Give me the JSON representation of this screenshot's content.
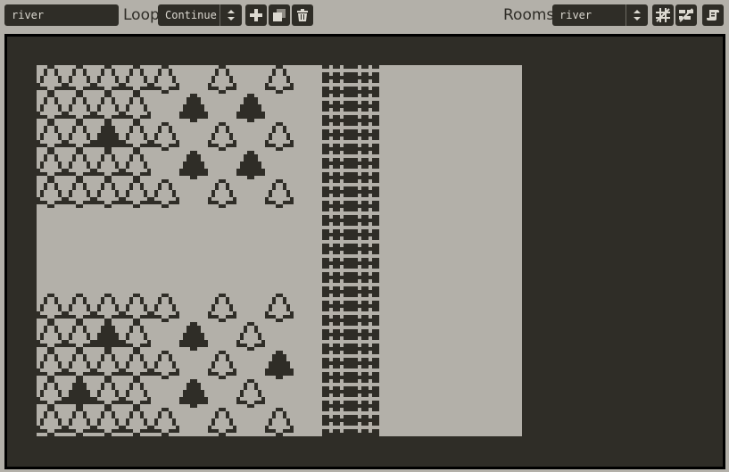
{
  "toolbar": {
    "room_name_value": "river",
    "loop_label": "Loop",
    "loop_select_value": "Continue",
    "rooms_label": "Rooms",
    "rooms_select_value": "river"
  },
  "colors": {
    "light": "#b3b0a9",
    "dark": "#2f2d27",
    "border": "#000000"
  },
  "game": {
    "grid_cols": 17,
    "grid_rows": 13,
    "rows": [
      "ooooo.o.o.MM.....",
      "oooo.T.T..MM.....",
      "ooToo.o.o.MM.....",
      "oooo.T.T..MM.....",
      "ooooo.o.o.MM.....",
      "..........MM.....",
      "..........MM.....",
      "..........MM.....",
      "ooooo.o.o.MM.....",
      "ooTo.T.o..MM.....",
      "ooooo.o.T.MM.....",
      "oToo.T.o..MM.....",
      "ooooo.o.o.MM....."
    ],
    "legend": {
      "o": "outline-tree-sprite",
      "T": "solid-tree-sprite",
      "M": "river-water-tile",
      ".": "empty-floor"
    }
  }
}
